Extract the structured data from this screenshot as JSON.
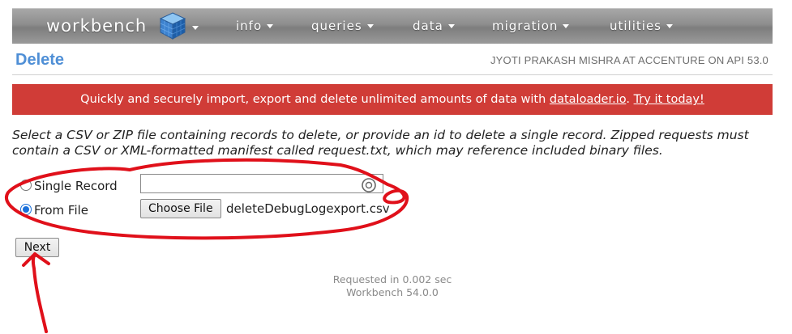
{
  "nav": {
    "logo_text": "workbench",
    "items": [
      {
        "label": "info"
      },
      {
        "label": "queries"
      },
      {
        "label": "data"
      },
      {
        "label": "migration"
      },
      {
        "label": "utilities"
      }
    ]
  },
  "header": {
    "title": "Delete",
    "user_info": "JYOTI PRAKASH MISHRA AT ACCENTURE ON API 53.0"
  },
  "banner": {
    "text_before": "Quickly and securely import, export and delete unlimited amounts of data with ",
    "link_text": "dataloader.io",
    "text_middle": ". ",
    "cta_text": "Try it today!",
    "background_color": "#d03c37"
  },
  "instructions": "Select a CSV or ZIP file containing records to delete, or provide an id to delete a single record. Zipped requests must contain a CSV or XML-formatted manifest called request.txt, which may reference included binary files.",
  "form": {
    "single_record_label": "Single Record",
    "single_record_selected": false,
    "single_record_value": "",
    "from_file_label": "From File",
    "from_file_selected": true,
    "choose_file_label": "Choose File",
    "selected_file_name": "deleteDebugLogexport.csv",
    "next_label": "Next"
  },
  "footer": {
    "request_time": "Requested in 0.002 sec",
    "version": "Workbench 54.0.0"
  },
  "colors": {
    "title_blue": "#4f8fd6",
    "annotation_red": "#e0101a"
  },
  "icons": {
    "logo": "cube-icon",
    "input_overlay": "lifebuoy-icon"
  }
}
